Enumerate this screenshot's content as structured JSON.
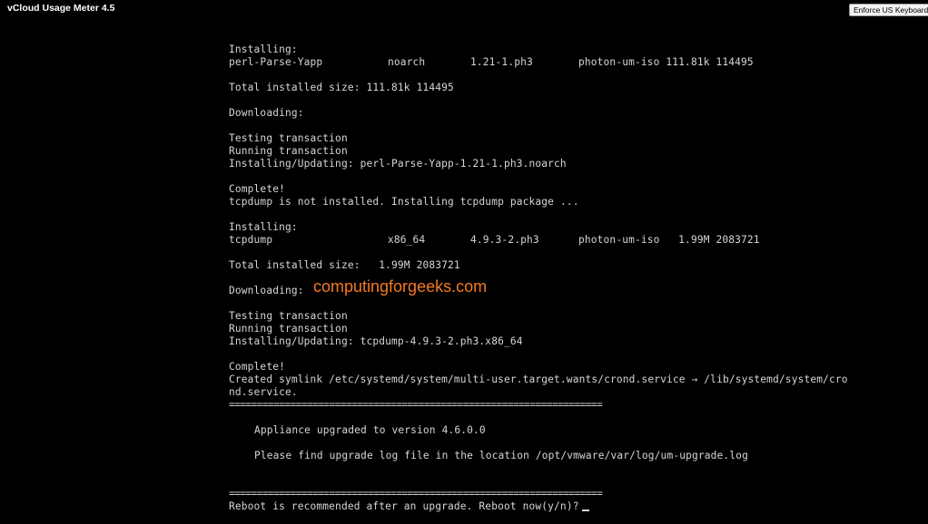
{
  "window": {
    "title": "vCloud Usage Meter 4.5"
  },
  "toolbar": {
    "keyboard_button_label": "Enforce US Keyboard Layout"
  },
  "console": {
    "block1": {
      "installing_label": "Installing:",
      "pkg": {
        "name": "perl-Parse-Yapp",
        "arch": "noarch",
        "version": "1.21-1.ph3",
        "repo": "photon-um-iso 111.81k 114495"
      },
      "total_size": "Total installed size: 111.81k 114495",
      "downloading": "Downloading:",
      "testing": "Testing transaction",
      "running": "Running transaction",
      "updating": "Installing/Updating: perl-Parse-Yapp-1.21-1.ph3.noarch",
      "complete": "Complete!",
      "tcpdump_notice": "tcpdump is not installed. Installing tcpdump package ..."
    },
    "block2": {
      "installing_label": "Installing:",
      "pkg": {
        "name": "tcpdump",
        "arch": "x86_64",
        "version": "4.9.3-2.ph3",
        "repo": "photon-um-iso   1.99M 2083721"
      },
      "total_size": "Total installed size:   1.99M 2083721",
      "downloading": "Downloading:",
      "testing": "Testing transaction",
      "running": "Running transaction",
      "updating": "Installing/Updating: tcpdump-4.9.3-2.ph3.x86_64",
      "complete": "Complete!",
      "symlink_line1": "Created symlink /etc/systemd/system/multi-user.target.wants/crond.service → /lib/systemd/system/cro",
      "symlink_line2": "nd.service."
    },
    "separator": "===================================================================",
    "upgrade_message": "Appliance upgraded to version 4.6.0.0",
    "log_message": "Please find upgrade log file in the location /opt/vmware/var/log/um-upgrade.log",
    "reboot_prompt": "Reboot is recommended after an upgrade. Reboot now(y/n)?"
  },
  "watermark": {
    "text": "computingforgeeks.com",
    "color": "#f47920"
  },
  "colors": {
    "background": "#000000",
    "console_text": "#d6d6d6"
  }
}
